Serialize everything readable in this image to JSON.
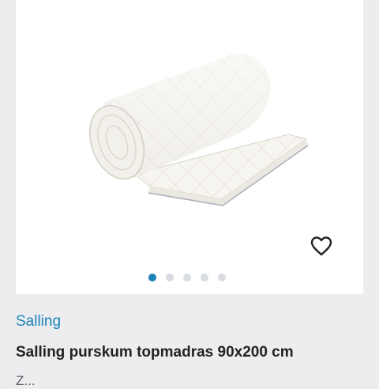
{
  "product": {
    "brand": "Salling",
    "title": "Salling purskum topmadras 90x200 cm",
    "subtitle": "Z..."
  },
  "gallery": {
    "image_count": 5,
    "active_index": 0
  },
  "icons": {
    "favorite": "heart-outline-icon"
  },
  "colors": {
    "accent": "#1a84b8",
    "page_background": "#ededf0",
    "dot_inactive": "#d9dce2",
    "title": "#222222"
  }
}
